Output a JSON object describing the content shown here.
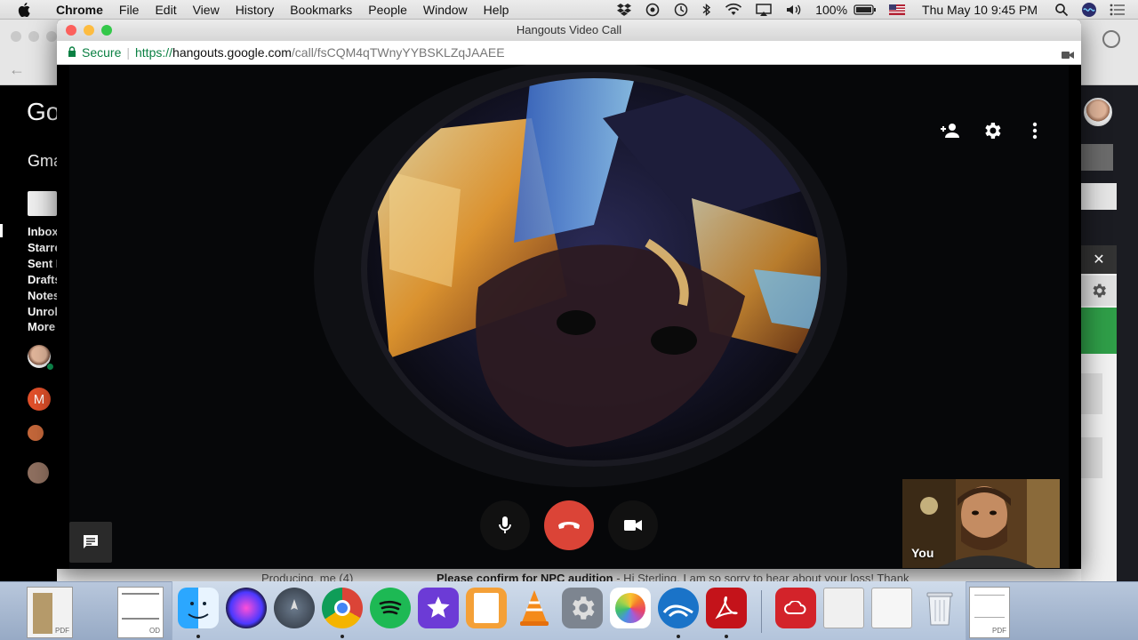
{
  "menubar": {
    "app": "Chrome",
    "items": [
      "File",
      "Edit",
      "View",
      "History",
      "Bookmarks",
      "People",
      "Window",
      "Help"
    ],
    "battery": "100%",
    "datetime": "Thu May 10  9:45 PM"
  },
  "window": {
    "title": "Hangouts Video Call",
    "secure_label": "Secure",
    "url_scheme": "https://",
    "url_host": "hangouts.google.com",
    "url_path": "/call/fsCQM4qTWnyYYBSKLZqJAAEE"
  },
  "call": {
    "self_label": "You"
  },
  "gmail_bg": {
    "logo": "Go",
    "app": "Gma",
    "nav": [
      "Inbox",
      "Starre",
      "Sent I",
      "Drafts",
      "Notes",
      "Unroll",
      "More"
    ],
    "avatar_letter": "M",
    "bottom_row": {
      "sender": "Producing, me (4)",
      "subject": "Please confirm for NPC audition",
      "snippet": " - Hi Sterling, I am so sorry to hear about your loss! Thank"
    }
  },
  "dock": {
    "doc_labels": [
      "PDF",
      "OD",
      "PDF"
    ]
  },
  "colors": {
    "end_call_red": "#db4437",
    "secure_green": "#0b8043",
    "traffic_red": "#fc605c",
    "traffic_yellow": "#fdbc40",
    "traffic_green": "#34c84a"
  }
}
